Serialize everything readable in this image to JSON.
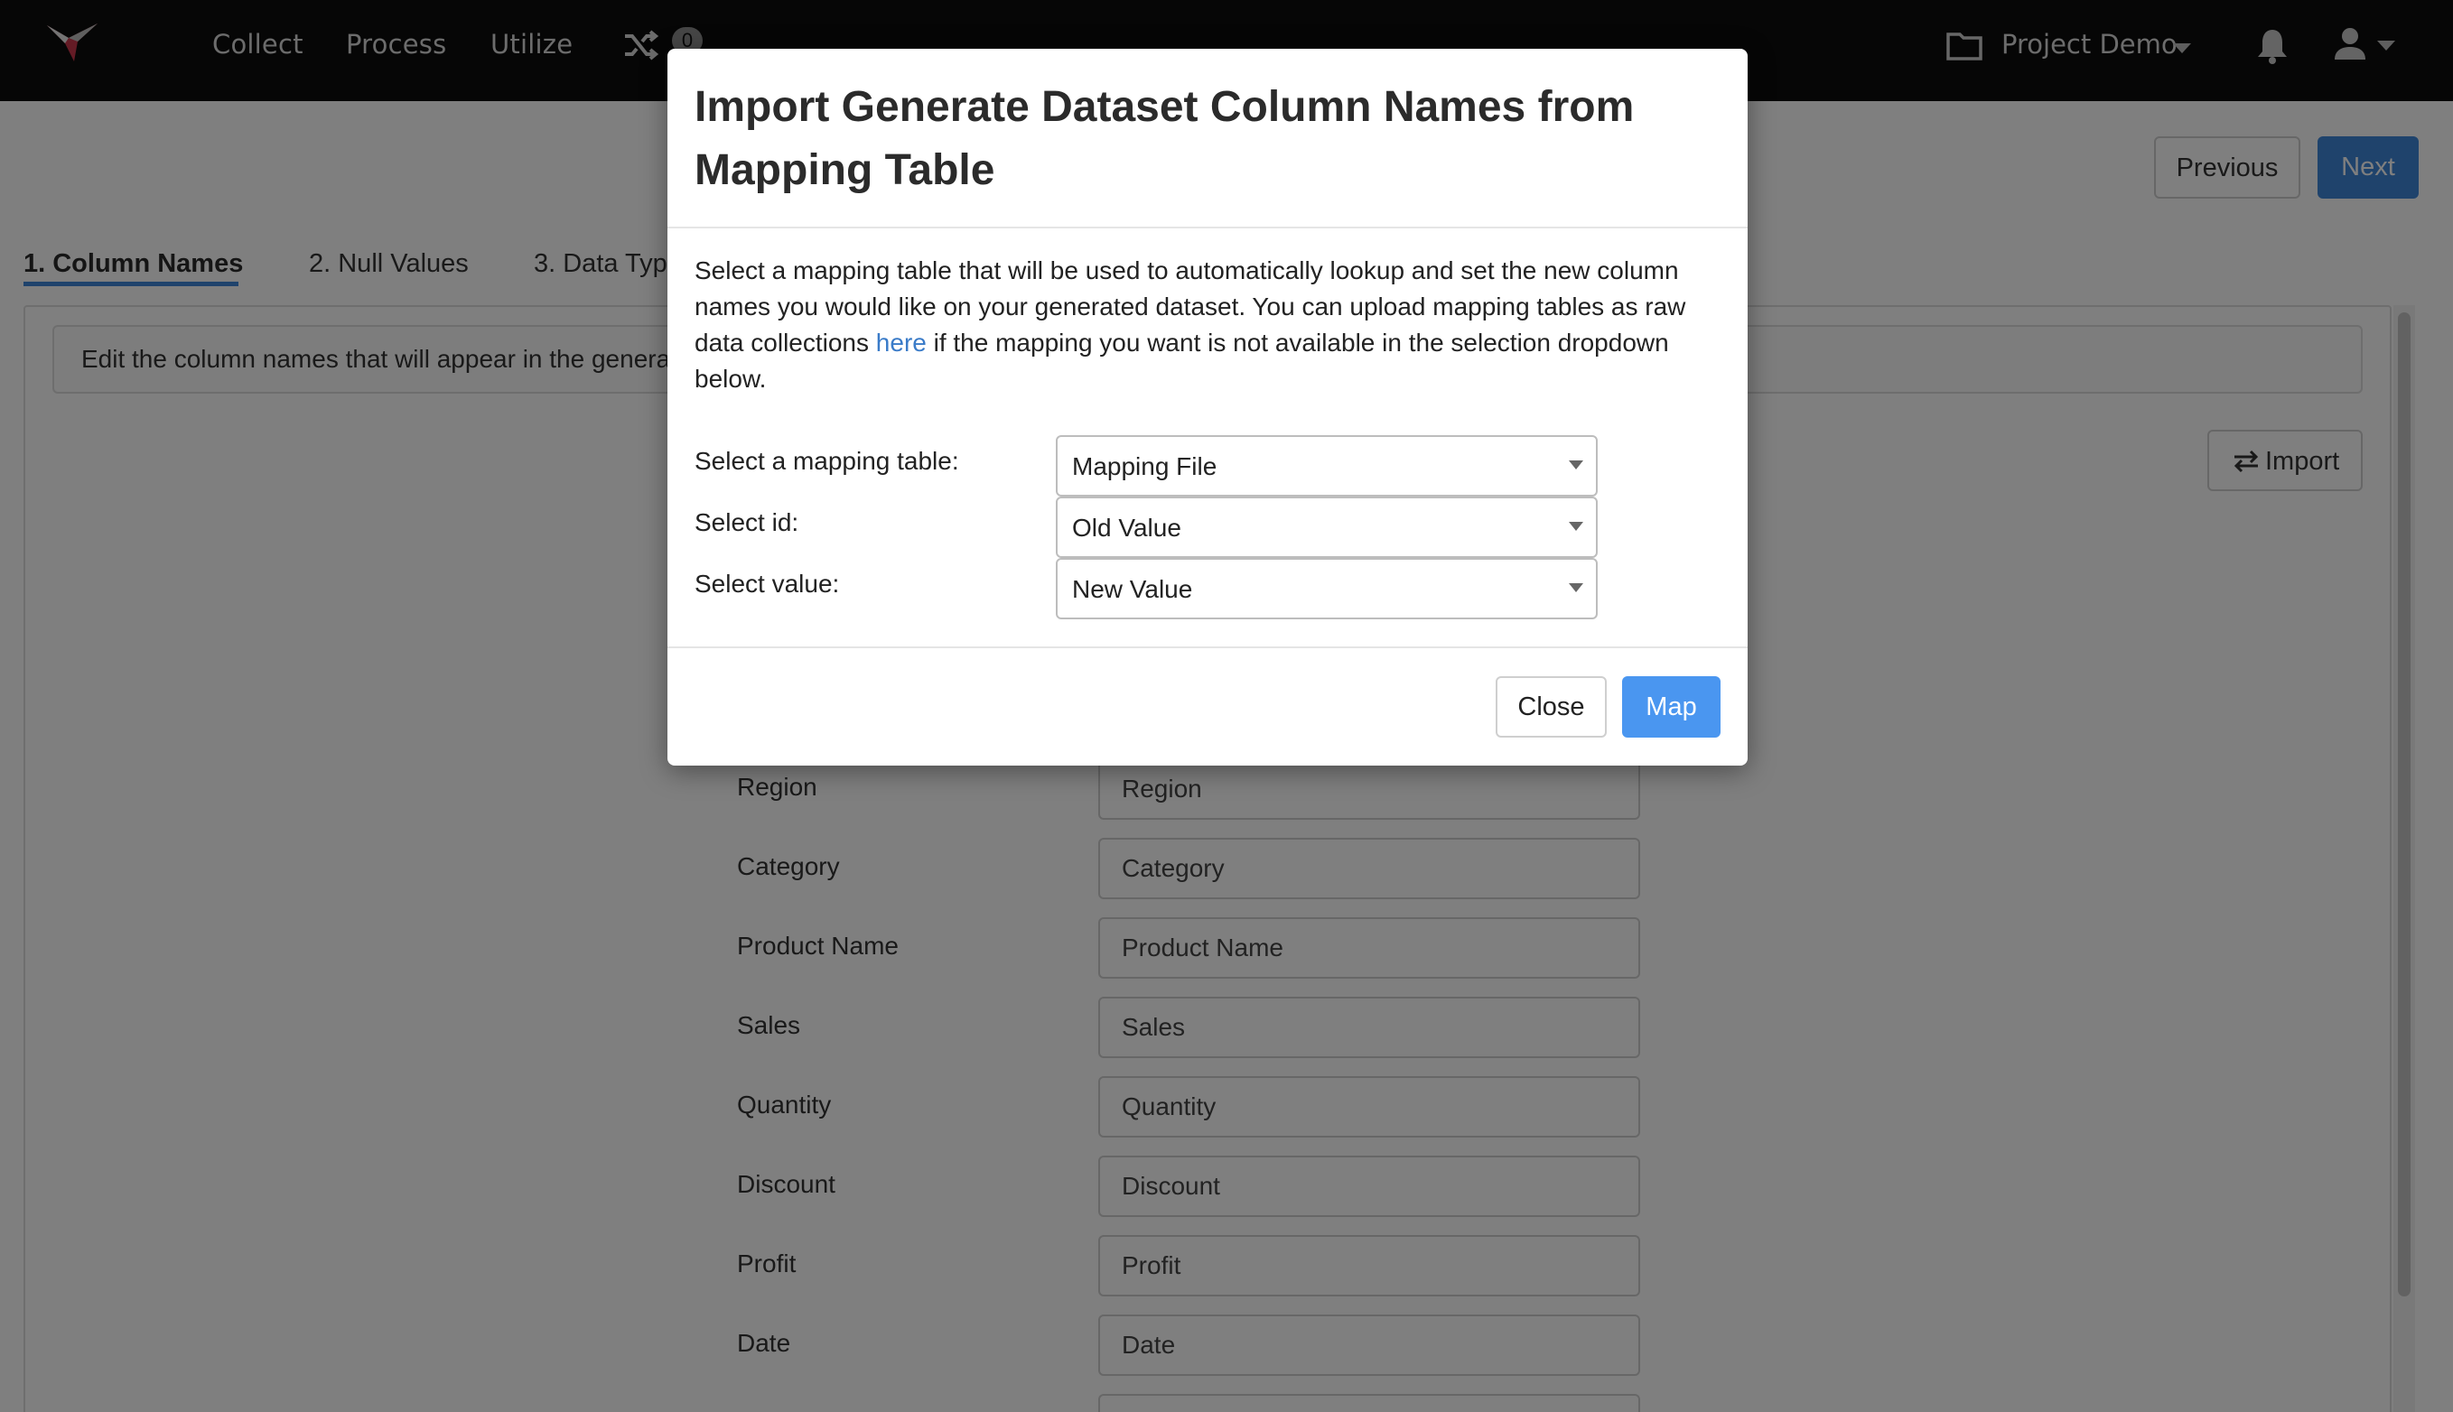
{
  "nav": {
    "links": [
      "Collect",
      "Process",
      "Utilize"
    ],
    "shuffle_badge": "0",
    "project_label": "Project Demo",
    "icons": [
      "hummingbird-logo-icon",
      "shuffle-icon",
      "folder-icon",
      "bell-icon",
      "user-icon"
    ]
  },
  "wizard": {
    "previous_label": "Previous",
    "next_label": "Next",
    "steps": [
      "1. Column Names",
      "2. Null Values",
      "3. Data Type"
    ],
    "active_step": 0,
    "info_text": "Edit the column names that will appear in the genera",
    "import_label": "Import",
    "rows": [
      {
        "label": "Region",
        "value": "Region"
      },
      {
        "label": "Category",
        "value": "Category"
      },
      {
        "label": "Product Name",
        "value": "Product Name"
      },
      {
        "label": "Sales",
        "value": "Sales"
      },
      {
        "label": "Quantity",
        "value": "Quantity"
      },
      {
        "label": "Discount",
        "value": "Discount"
      },
      {
        "label": "Profit",
        "value": "Profit"
      },
      {
        "label": "Date",
        "value": "Date"
      }
    ]
  },
  "modal": {
    "title": "Import Generate Dataset Column Names from Mapping Table",
    "desc_before": "Select a mapping table that will be used to automatically lookup and set the new column names you would like on your generated dataset. You can upload mapping tables as raw data collections ",
    "desc_link": "here",
    "desc_after": " if the mapping you want is not available in the selection dropdown below.",
    "fields": [
      {
        "label": "Select a mapping table:",
        "value": "Mapping File"
      },
      {
        "label": "Select id:",
        "value": "Old Value"
      },
      {
        "label": "Select value:",
        "value": "New Value"
      }
    ],
    "close_label": "Close",
    "map_label": "Map"
  },
  "colors": {
    "navbar": "#0d0d0d",
    "primary": "#3f86d8",
    "map_button": "#4a96f0",
    "link": "#3a7bc8"
  }
}
